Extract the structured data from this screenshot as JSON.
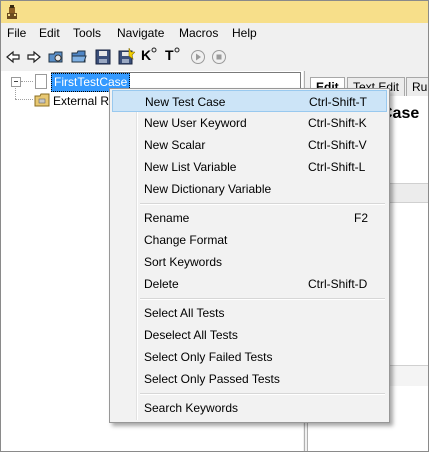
{
  "menubar": {
    "items": [
      "File",
      "Edit",
      "Tools",
      "Navigate",
      "Macros",
      "Help"
    ]
  },
  "toolbar": {
    "icons": [
      "back-arrow-icon",
      "forward-arrow-icon",
      "open-project-icon",
      "open-folder-icon",
      "save-icon",
      "save-all-icon",
      "search-keywords-icon",
      "search-tests-icon",
      "run-icon",
      "stop-icon"
    ],
    "keyword_glyph": "K",
    "test_glyph": "T"
  },
  "tree": {
    "selected_item": "FirstTestCase",
    "external_item": "External Re"
  },
  "right_pane": {
    "tabs": [
      "Edit",
      "Text Edit",
      "Ru"
    ],
    "heading": "Case"
  },
  "context_menu": {
    "groups": [
      [
        {
          "label": "New Test Case",
          "shortcut": "Ctrl-Shift-T"
        },
        {
          "label": "New User Keyword",
          "shortcut": "Ctrl-Shift-K"
        },
        {
          "label": "New Scalar",
          "shortcut": "Ctrl-Shift-V"
        },
        {
          "label": "New List Variable",
          "shortcut": "Ctrl-Shift-L"
        },
        {
          "label": "New Dictionary Variable",
          "shortcut": ""
        }
      ],
      [
        {
          "label": "Rename",
          "shortcut": "F2"
        },
        {
          "label": "Change Format",
          "shortcut": ""
        },
        {
          "label": "Sort Keywords",
          "shortcut": ""
        },
        {
          "label": "Delete",
          "shortcut": "Ctrl-Shift-D"
        }
      ],
      [
        {
          "label": "Select All Tests",
          "shortcut": ""
        },
        {
          "label": "Deselect All Tests",
          "shortcut": ""
        },
        {
          "label": "Select Only Failed Tests",
          "shortcut": ""
        },
        {
          "label": "Select Only Passed Tests",
          "shortcut": ""
        }
      ],
      [
        {
          "label": "Search Keywords",
          "shortcut": ""
        }
      ]
    ],
    "highlighted": "New Test Case",
    "highlight_color": "#cce4f7"
  },
  "colors": {
    "titlebar": "#f7df8a",
    "selection": "#3399ff"
  }
}
